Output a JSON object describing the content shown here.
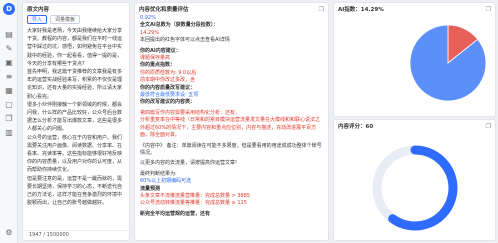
{
  "left": {
    "title": "原文内容",
    "tabs": [
      "导入",
      "词量模板"
    ],
    "paragraphs": [
      "大家好我是老杨，今天由我继续给大家分享干货。教程的内容，都是我们在平时一线运营中踩过的坑，感悟，如何避免在平台中实践中的经验，你一起看看，值得一提的是，今天的分享有哪些干货点？",
      "首先申明，我这篇干货推荐的文章我是有多年的运营实战经验来写，积累的不仅仅是理论知识，还有大量的实操经验，所以请大家耐心看完。",
      "很多小伙伴刚接触一个新领域的时候，都会问我，什么样的产品比较好，公众号后台数据怎么分析才能写出爆款文章，这些是很多人都关心的问题。",
      "公众号的运营，核心在于内容和用户。我们需要关注用户画像、阅读数据、分享率、在看率、完读率等，这些指标能够很好地反映你的内容质量，以及用户对你的认可度，从而帮助你持续优化。",
      "但是要注意的是，运营不是一蹴而就的，需要长期坚持，保持学习的心态，不断迭代自己的方法论，这样才能在竞争激烈的环境中脱颖而出，让自己的账号越做越好。"
    ],
    "counter": "1947 / 1500000"
  },
  "mid": {
    "title": "内容优化和质量评估",
    "lines": [
      {
        "t": "0.92%",
        "c": "blue"
      },
      {
        "t": "全文AI总数为（获数量分段检数）：",
        "c": "bold"
      },
      {
        "t": "14.29%",
        "c": "red"
      },
      {
        "t": "本回提出的红色字体可以点击查看AI详情",
        "c": ""
      },
      {
        "t": "",
        "c": "gap"
      },
      {
        "t": "你的AI内容建议：",
        "c": "bold"
      },
      {
        "t": "课题保存量高",
        "c": "red"
      },
      {
        "t": "你的重点指数：",
        "c": "bold"
      },
      {
        "t": "你的原质检数为: 9.0以后",
        "c": "red"
      },
      {
        "t": "前本期中你改过多改，含",
        "c": "red"
      },
      {
        "t": "你的内容质量改写建议：",
        "c": "bold"
      },
      {
        "t": "最低符合最低要求设: 五项",
        "c": "blue"
      },
      {
        "t": "你的改写建议的内容类：",
        "c": "bold"
      },
      {
        "t": "",
        "c": "gap"
      },
      {
        "t": "第四篇写作内容需要采用结构化分析：还有，",
        "c": "red"
      },
      {
        "t": "分析重复率在中等线（日常和的累目模块运营流量发文量在大模线和和联心说法之外超过60%的情况下，主要内容和重点应位别，内容与描述，充动改进展平百方面。除全面对其。",
        "c": "red"
      },
      {
        "t": "",
        "c": "gap"
      },
      {
        "t": "《内容中》 备注：单篇阅读在可能不多限度，但是要看用的用途成成功整体个账号情况。",
        "c": ""
      },
      {
        "t": "",
        "c": "gap"
      },
      {
        "t": "以更多内容的去流量，请按提高你运营文章!",
        "c": ""
      },
      {
        "t": "",
        "c": "gap"
      },
      {
        "t": "最终判断结果为:",
        "c": ""
      },
      {
        "t": "60%以上初期编码可选",
        "c": "blue"
      },
      {
        "t": "流量预测",
        "c": "bold"
      },
      {
        "t": "头条文章不流推流量营推量：完成总数量 > 3885",
        "c": "red"
      },
      {
        "t": "公众号流动转推流量等推量：完成总数量 ≥ 115",
        "c": "red"
      },
      {
        "t": "",
        "c": "gap"
      },
      {
        "t": "新完全平均运营规的运营，还有",
        "c": "bold"
      }
    ]
  },
  "ai_chart": {
    "title": "AI指数：14.29%",
    "icon": "copy-icon",
    "chart_data": {
      "type": "pie",
      "slices": [
        {
          "label": "AI",
          "value": 14.29,
          "color": "#e8605a"
        },
        {
          "label": "原创",
          "value": 85.71,
          "color": "#5b8ff9"
        }
      ]
    }
  },
  "score_chart": {
    "title": "内容评分：60",
    "icon": "copy-icon",
    "chart_data": {
      "type": "gauge",
      "value": 60,
      "max": 100,
      "color": "#2f6bff",
      "track": "#e8ecf5"
    }
  }
}
